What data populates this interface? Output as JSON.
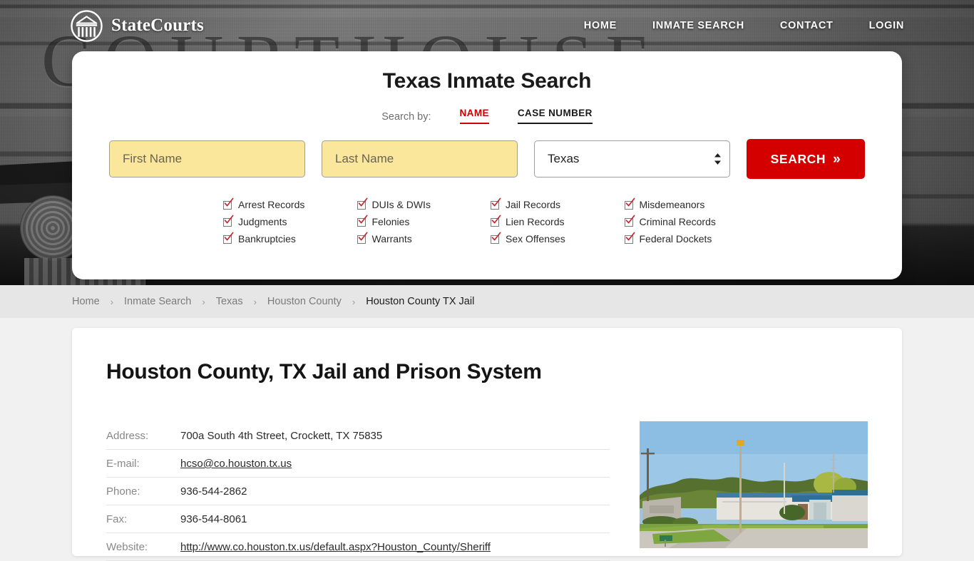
{
  "header": {
    "brand_name": "StateCourts",
    "brand_icon": "courthouse-logo-icon",
    "background_word": "COURTHOUSE",
    "nav": [
      {
        "label": "HOME"
      },
      {
        "label": "INMATE SEARCH"
      },
      {
        "label": "CONTACT"
      },
      {
        "label": "LOGIN"
      }
    ]
  },
  "search_panel": {
    "title": "Texas Inmate Search",
    "search_by_label": "Search by:",
    "tabs": [
      {
        "label": "NAME",
        "active": true
      },
      {
        "label": "CASE NUMBER",
        "active": false
      }
    ],
    "first_name": {
      "placeholder": "First Name",
      "value": ""
    },
    "last_name": {
      "placeholder": "Last Name",
      "value": ""
    },
    "state_select": {
      "value": "Texas"
    },
    "search_button": {
      "label": "SEARCH",
      "chevron": "»"
    },
    "accent_color": "#d40000",
    "input_fill_color": "#fbe79b",
    "record_types": [
      "Arrest Records",
      "Judgments",
      "Bankruptcies",
      "DUIs & DWIs",
      "Felonies",
      "Warrants",
      "Jail Records",
      "Lien Records",
      "Sex Offenses",
      "Misdemeanors",
      "Criminal Records",
      "Federal Dockets"
    ]
  },
  "breadcrumb": {
    "separator": "›",
    "items": [
      {
        "label": "Home",
        "current": false
      },
      {
        "label": "Inmate Search",
        "current": false
      },
      {
        "label": "Texas",
        "current": false
      },
      {
        "label": "Houston County",
        "current": false
      },
      {
        "label": "Houston County TX Jail",
        "current": true
      }
    ]
  },
  "main": {
    "page_title": "Houston County, TX Jail and Prison System",
    "details": [
      {
        "label": "Address:",
        "value": "700a South 4th Street, Crockett, TX 75835",
        "link": false
      },
      {
        "label": "E-mail:",
        "value": "hcso@co.houston.tx.us",
        "link": true
      },
      {
        "label": "Phone:",
        "value": "936-544-2862",
        "link": false
      },
      {
        "label": "Fax:",
        "value": "936-544-8061",
        "link": false
      },
      {
        "label": "Website:",
        "value": "http://www.co.houston.tx.us/default.aspx?Houston_County/Sheriff",
        "link": true
      }
    ],
    "photo_alt": "jail-building-photo"
  }
}
